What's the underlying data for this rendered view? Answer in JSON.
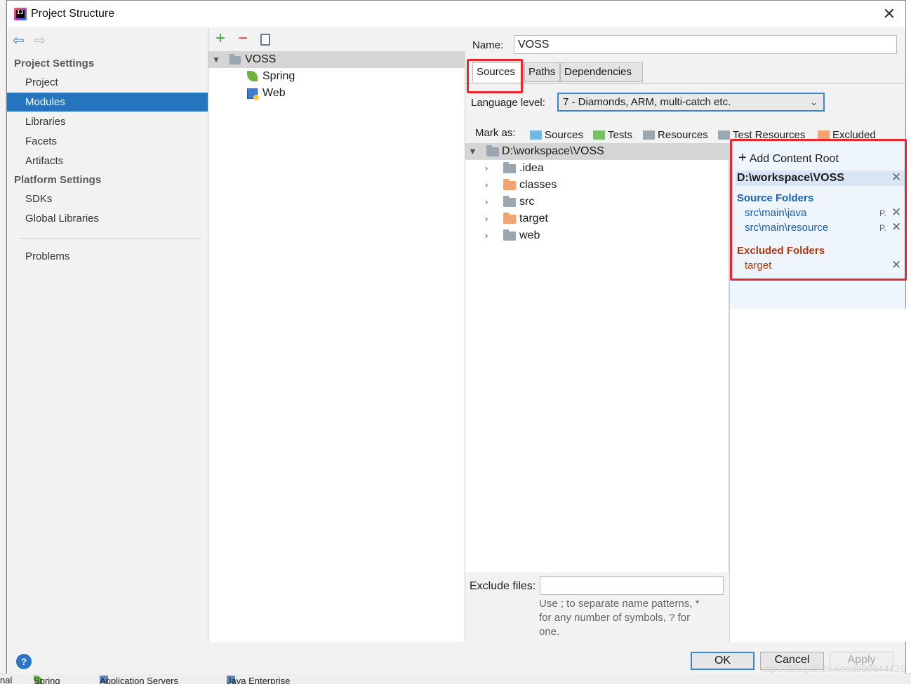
{
  "window": {
    "title": "Project Structure"
  },
  "sidebar": {
    "project_settings_heading": "Project Settings",
    "project_items": [
      "Project",
      "Modules",
      "Libraries",
      "Facets",
      "Artifacts"
    ],
    "selected_item": "Modules",
    "platform_settings_heading": "Platform Settings",
    "platform_items": [
      "SDKs",
      "Global Libraries"
    ],
    "problems": "Problems"
  },
  "module_tree": {
    "root": "VOSS",
    "children": [
      "Spring",
      "Web"
    ]
  },
  "module": {
    "name_label": "Name:",
    "name_value": "VOSS",
    "tabs": [
      "Sources",
      "Paths",
      "Dependencies"
    ],
    "active_tab": "Sources",
    "language_level_label": "Language level:",
    "language_level_value": "7 - Diamonds, ARM, multi-catch etc.",
    "mark_as_label": "Mark as:",
    "mark_as": [
      {
        "label": "Sources",
        "color": "#6fb8e6"
      },
      {
        "label": "Tests",
        "color": "#73c45a"
      },
      {
        "label": "Resources",
        "color": "#9aa7b0"
      },
      {
        "label": "Test Resources",
        "color": "#9aa7b0"
      },
      {
        "label": "Excluded",
        "color": "#f3a36b"
      }
    ]
  },
  "file_tree": {
    "root": "D:\\workspace\\VOSS",
    "items": [
      {
        "label": ".idea",
        "color": "#9aa7b0"
      },
      {
        "label": "classes",
        "color": "#f3a36b"
      },
      {
        "label": "src",
        "color": "#9aa7b0"
      },
      {
        "label": "target",
        "color": "#f3a36b"
      },
      {
        "label": "web",
        "color": "#9aa7b0"
      }
    ]
  },
  "content_root_panel": {
    "add_label": "Add Content Root",
    "root": "D:\\workspace\\VOSS",
    "source_folders_heading": "Source Folders",
    "source_folders_color": "#1a5fb4",
    "source_folders": [
      "src\\main\\java",
      "src\\main\\resource"
    ],
    "excluded_folders_heading": "Excluded Folders",
    "excluded_folders_color": "#a93a12",
    "excluded_folders": [
      "target"
    ]
  },
  "exclude_files": {
    "label": "Exclude files:",
    "value": "",
    "hint_line1": "Use ; to separate name patterns, *",
    "hint_line2": "for any number of symbols, ? for",
    "hint_line3": "one."
  },
  "footer": {
    "help": "?",
    "ok": "OK",
    "cancel": "Cancel",
    "apply": "Apply"
  },
  "background_window_tabs": [
    "nal",
    "Spring",
    "Application Servers",
    "Java Enterprise"
  ],
  "watermark": "https://blog.csdn.net/a690844125",
  "accent_color": "#2675bf",
  "highlight_color": "#e8262b"
}
